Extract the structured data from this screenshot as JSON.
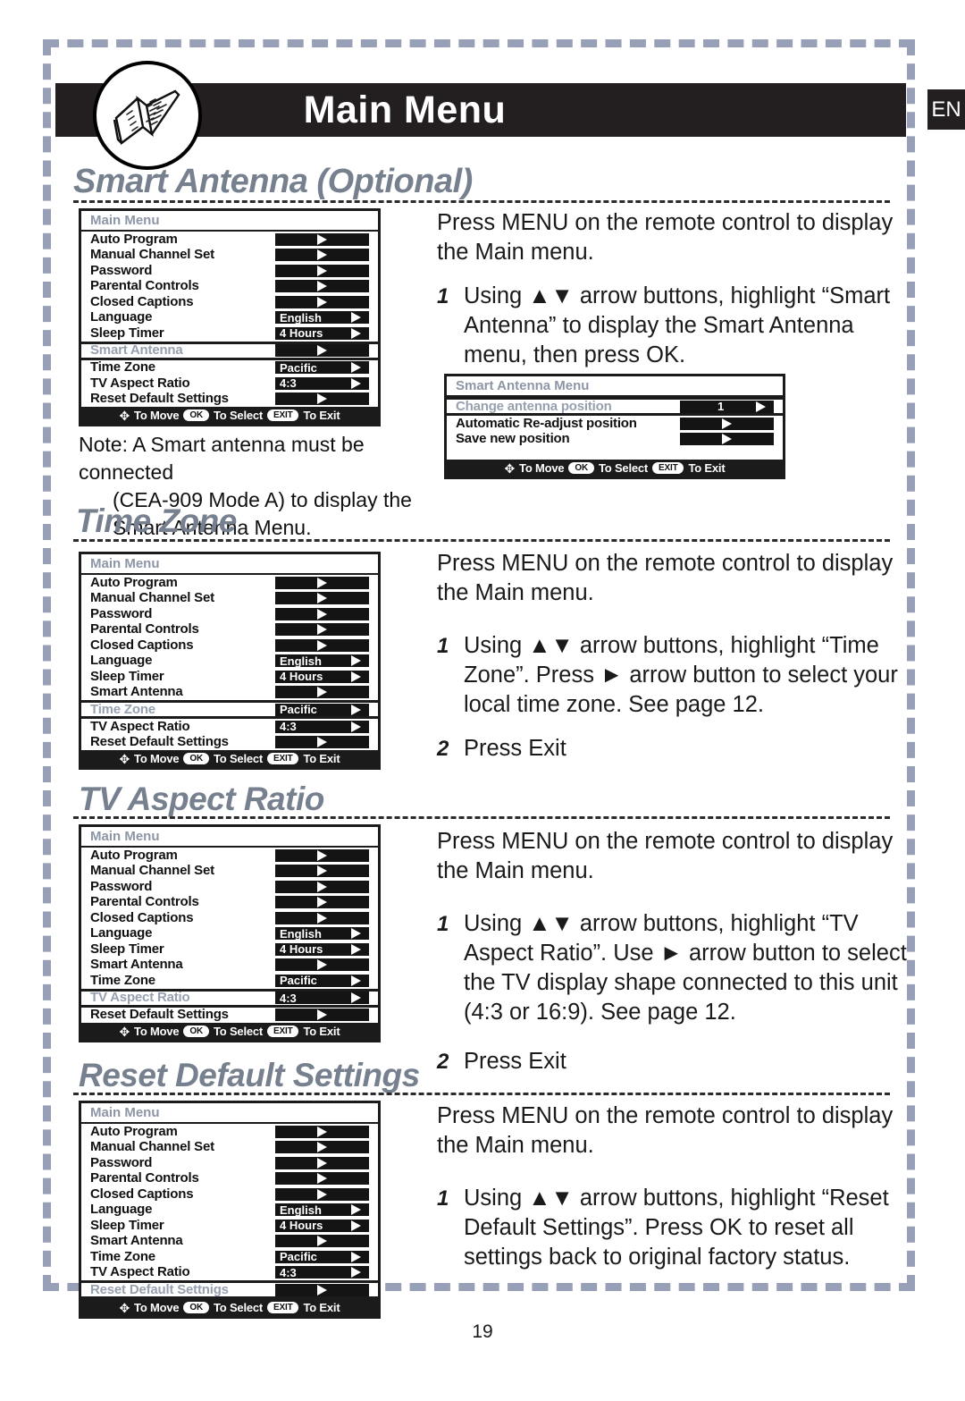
{
  "page": {
    "title": "Main Menu",
    "language_badge": "EN",
    "page_number": "19",
    "book_icon": "open-book-icon"
  },
  "menu_common": {
    "title": "Main Menu",
    "footer": {
      "move_glyph": "✥",
      "move_label": "To Move",
      "ok_pill": "OK",
      "select_label": "To Select",
      "exit_pill": "EXIT",
      "exit_label": "To Exit"
    },
    "values": {
      "language": "English",
      "sleep_timer": "4 Hours",
      "time_zone": "Pacific",
      "aspect_ratio": "4:3",
      "antenna_position": "1"
    },
    "labels": {
      "auto_program": "Auto Program",
      "manual_channel_set": "Manual Channel Set",
      "password": "Password",
      "parental_controls": "Parental Controls",
      "closed_captions": "Closed Captions",
      "language": "Language",
      "sleep_timer": "Sleep Timer",
      "smart_antenna": "Smart Antenna",
      "time_zone": "Time Zone",
      "tv_aspect_ratio": "TV Aspect Ratio",
      "reset_default_settings": "Reset Default Settings",
      "reset_default_settings_typo": "Reset Default Settnigs"
    }
  },
  "smart_antenna_menu": {
    "title": "Smart Antenna Menu",
    "rows": {
      "change_position": "Change antenna position",
      "auto_readjust": "Automatic Re-adjust position",
      "save_new": "Save new position"
    }
  },
  "sections": [
    {
      "heading": "Smart Antenna (Optional)",
      "intro": "Press MENU on the remote control to display the Main menu.",
      "steps": [
        {
          "num": "1",
          "text": "Using ▲▼ arrow buttons, highlight “Smart Antenna” to display the Smart Antenna menu, then press OK."
        }
      ],
      "note_lead": "Note: A Smart antenna must be connected",
      "note_line2": "(CEA-909 Mode A) to display the",
      "note_line3": "Smart Antenna Menu."
    },
    {
      "heading": "Time Zone",
      "intro": "Press MENU on the remote control to display the Main menu.",
      "steps": [
        {
          "num": "1",
          "text": "Using ▲▼ arrow buttons, highlight “Time Zone”. Press ► arrow button to select your local time zone. See page 12."
        },
        {
          "num": "2",
          "text": "Press Exit"
        }
      ]
    },
    {
      "heading": "TV Aspect Ratio",
      "intro": "Press MENU on the remote control to display the Main menu.",
      "steps": [
        {
          "num": "1",
          "text": "Using ▲▼ arrow buttons, highlight “TV Aspect Ratio”. Use ► arrow button to select the TV display shape connected to this unit (4:3 or 16:9). See page 12."
        },
        {
          "num": "2",
          "text": "Press Exit"
        }
      ]
    },
    {
      "heading": "Reset Default Settings",
      "intro": "Press MENU on the remote control to display the Main menu.",
      "steps": [
        {
          "num": "1",
          "text": "Using ▲▼ arrow buttons, highlight “Reset Default Settings”. Press OK to reset all settings back to original factory status."
        }
      ]
    }
  ]
}
